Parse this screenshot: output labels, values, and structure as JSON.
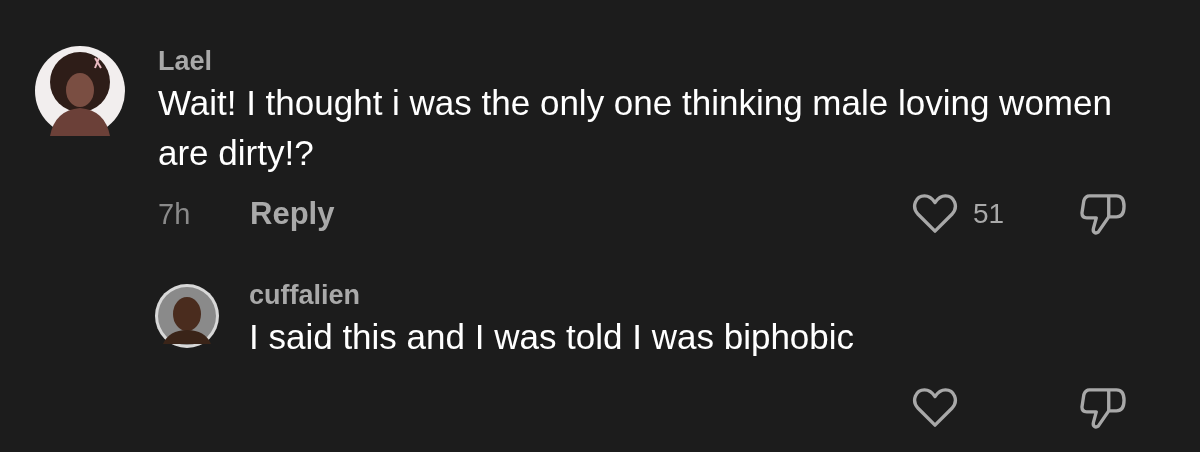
{
  "comments": [
    {
      "author": "Lael",
      "text": "Wait! I thought i was the only one thinking male loving women are dirty!?",
      "time": "7h",
      "reply_label": "Reply",
      "likes": "51",
      "replies": [
        {
          "author": "cuffalien",
          "text": "I said this and I was told I was biphobic"
        }
      ]
    }
  ]
}
